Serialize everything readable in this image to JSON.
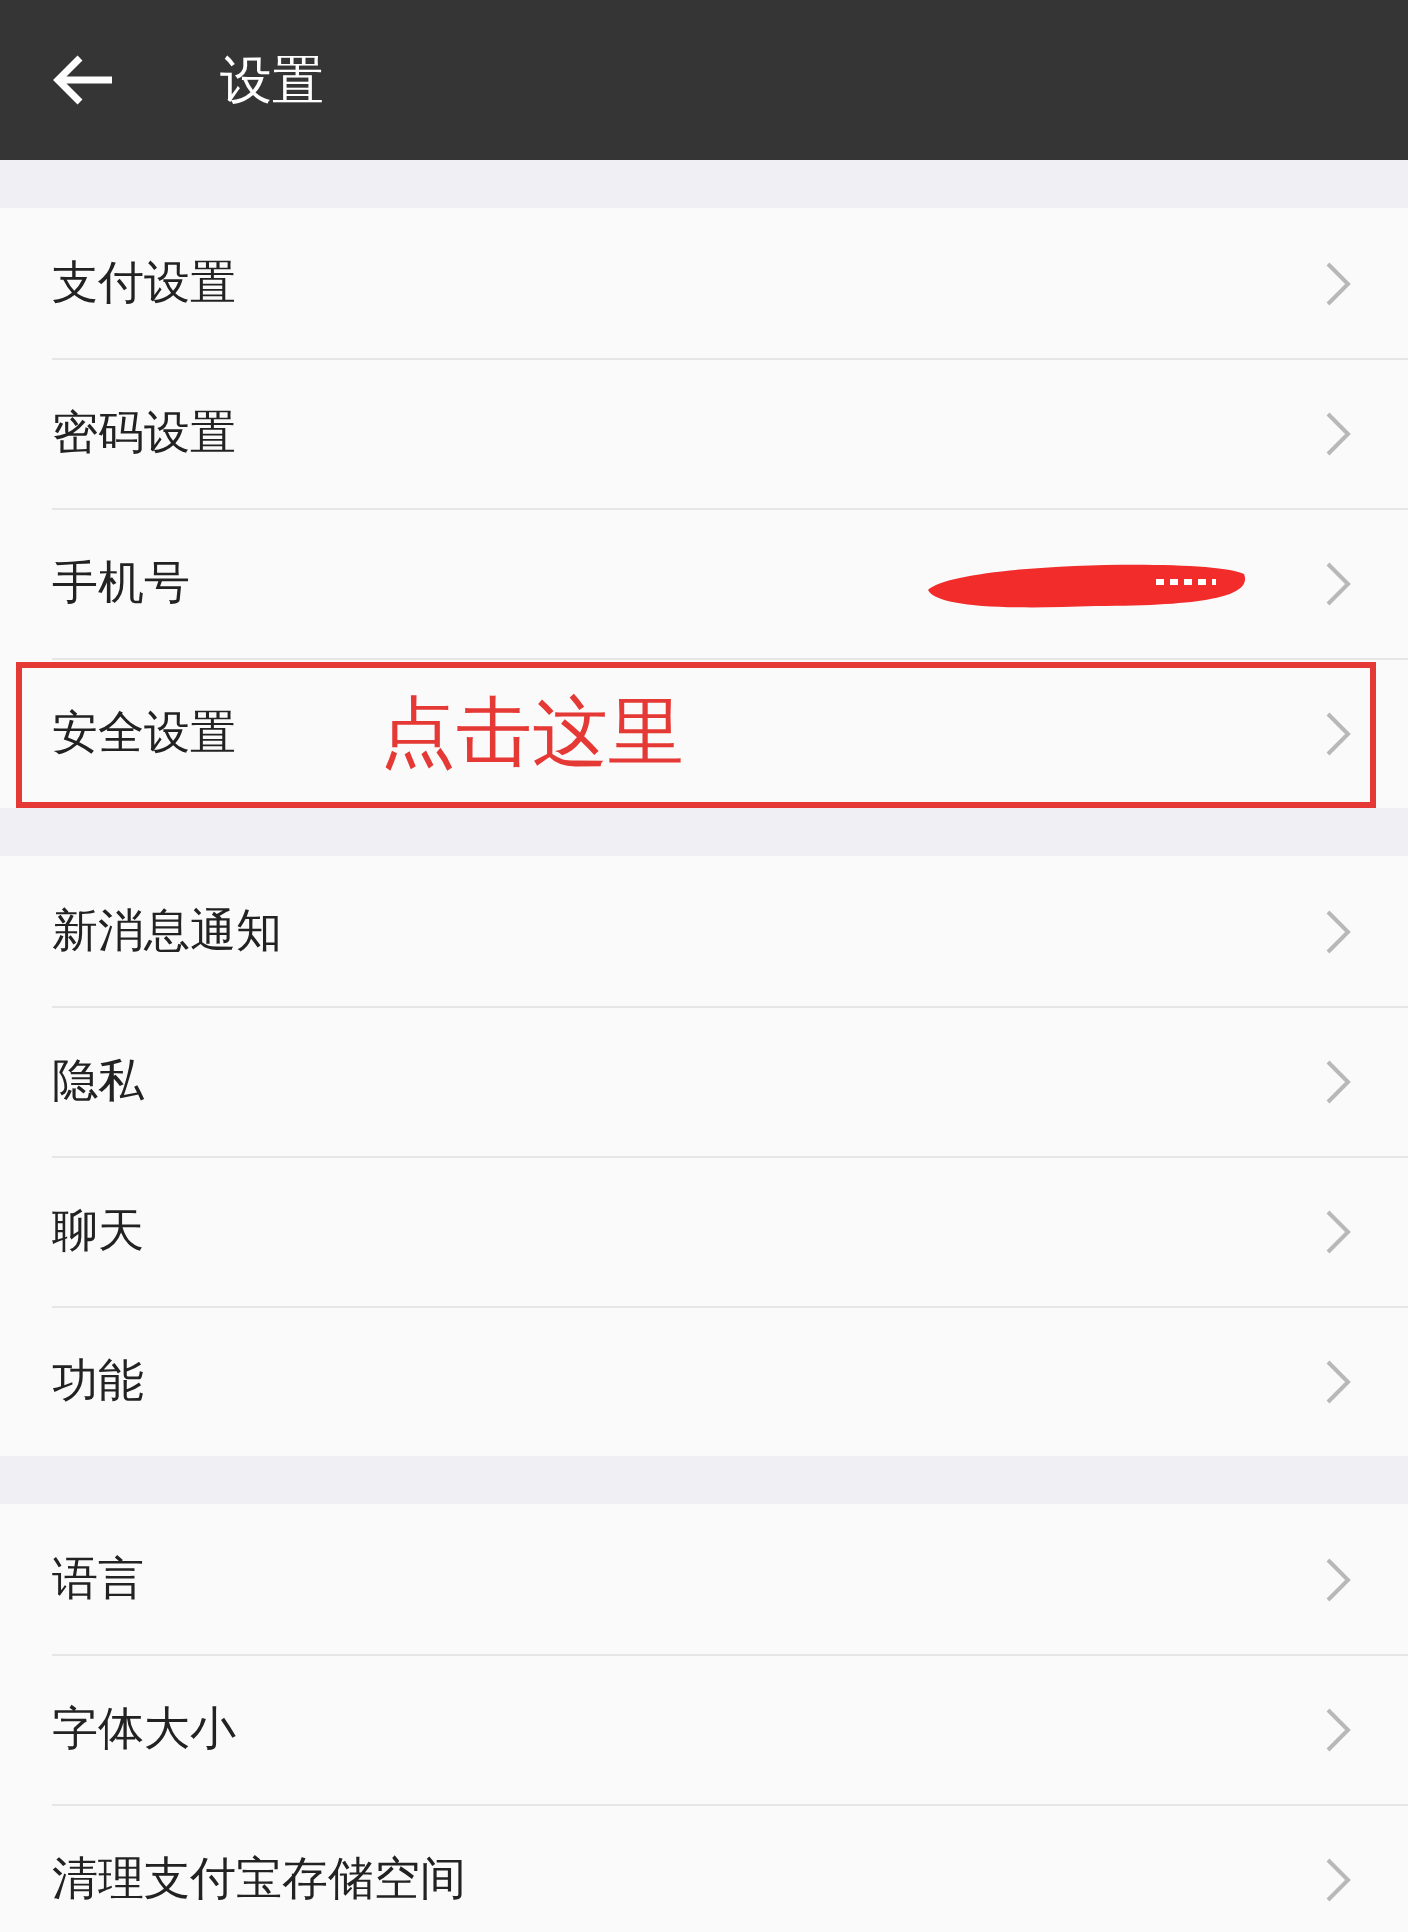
{
  "header": {
    "title": "设置"
  },
  "groups": [
    {
      "items": [
        {
          "label": "支付设置",
          "highlighted": false,
          "redacted": false
        },
        {
          "label": "密码设置",
          "highlighted": false,
          "redacted": false
        },
        {
          "label": "手机号",
          "highlighted": false,
          "redacted": true
        },
        {
          "label": "安全设置",
          "highlighted": true,
          "redacted": false,
          "annotation": "点击这里"
        }
      ]
    },
    {
      "items": [
        {
          "label": "新消息通知",
          "highlighted": false,
          "redacted": false
        },
        {
          "label": "隐私",
          "highlighted": false,
          "redacted": false
        },
        {
          "label": "聊天",
          "highlighted": false,
          "redacted": false
        },
        {
          "label": "功能",
          "highlighted": false,
          "redacted": false
        }
      ]
    },
    {
      "items": [
        {
          "label": "语言",
          "highlighted": false,
          "redacted": false
        },
        {
          "label": "字体大小",
          "highlighted": false,
          "redacted": false
        },
        {
          "label": "清理支付宝存储空间",
          "highlighted": false,
          "redacted": false
        }
      ]
    }
  ]
}
